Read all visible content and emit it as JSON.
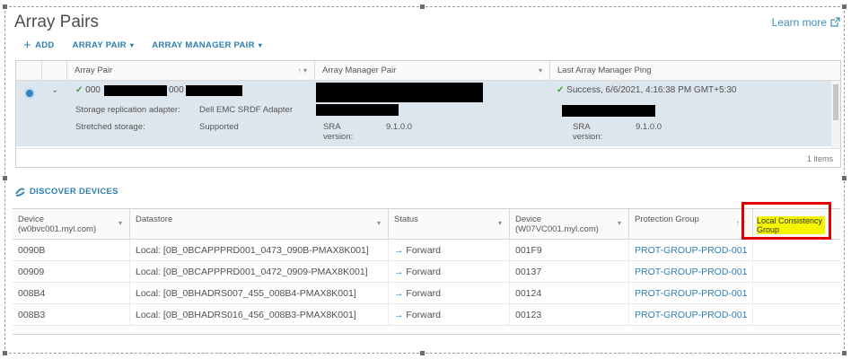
{
  "page": {
    "title": "Array Pairs",
    "learn_more": "Learn more"
  },
  "toolbar": {
    "add": "ADD",
    "array_pair": "ARRAY PAIR",
    "array_manager_pair": "ARRAY MANAGER PAIR"
  },
  "array_grid": {
    "columns": [
      "Array Pair",
      "Array Manager Pair",
      "Last Array Manager Ping"
    ],
    "row": {
      "pair_a": "000",
      "pair_b": "000",
      "sra_label": "Storage replication adapter:",
      "sra_value": "Dell EMC SRDF Adapter",
      "stretched_label": "Stretched storage:",
      "stretched_value": "Supported",
      "sra_version_label": "SRA version:",
      "sra_version_1": "9.1.0.0",
      "ping_status": "Success, 6/6/2021, 4:16:38 PM GMT+5:30",
      "sra_version_2": "9.1.0.0"
    },
    "footer": "1 items"
  },
  "discover": {
    "label": "DISCOVER DEVICES"
  },
  "device_grid": {
    "columns": {
      "device1": "Device (w0bvc001.myl.com)",
      "datastore": "Datastore",
      "status": "Status",
      "device2": "Device (W07VC001.myl.com)",
      "protection_group": "Protection Group",
      "local_cg": "Local Consistency Group"
    },
    "rows": [
      {
        "device1": "0090B",
        "datastore": "Local: [0B_0BCAPPPRD001_0473_090B-PMAX8K001]",
        "status": "Forward",
        "device2": "001F9",
        "pg": "PROT-GROUP-PROD-001"
      },
      {
        "device1": "00909",
        "datastore": "Local: [0B_0BCAPPPRD001_0472_0909-PMAX8K001]",
        "status": "Forward",
        "device2": "00137",
        "pg": "PROT-GROUP-PROD-001"
      },
      {
        "device1": "008B4",
        "datastore": "Local: [0B_0BHADRS007_455_008B4-PMAX8K001]",
        "status": "Forward",
        "device2": "00124",
        "pg": "PROT-GROUP-PROD-001"
      },
      {
        "device1": "008B3",
        "datastore": "Local: [0B_0BHADRS016_456_008B3-PMAX8K001]",
        "status": "Forward",
        "device2": "00123",
        "pg": "PROT-GROUP-PROD-001"
      }
    ]
  },
  "colors": {
    "accent": "#2e7fb0",
    "selected_row": "#dde6ed",
    "success": "#3a9a3a",
    "highlight_box": "#e00000",
    "highlight_text": "#f5f500"
  }
}
